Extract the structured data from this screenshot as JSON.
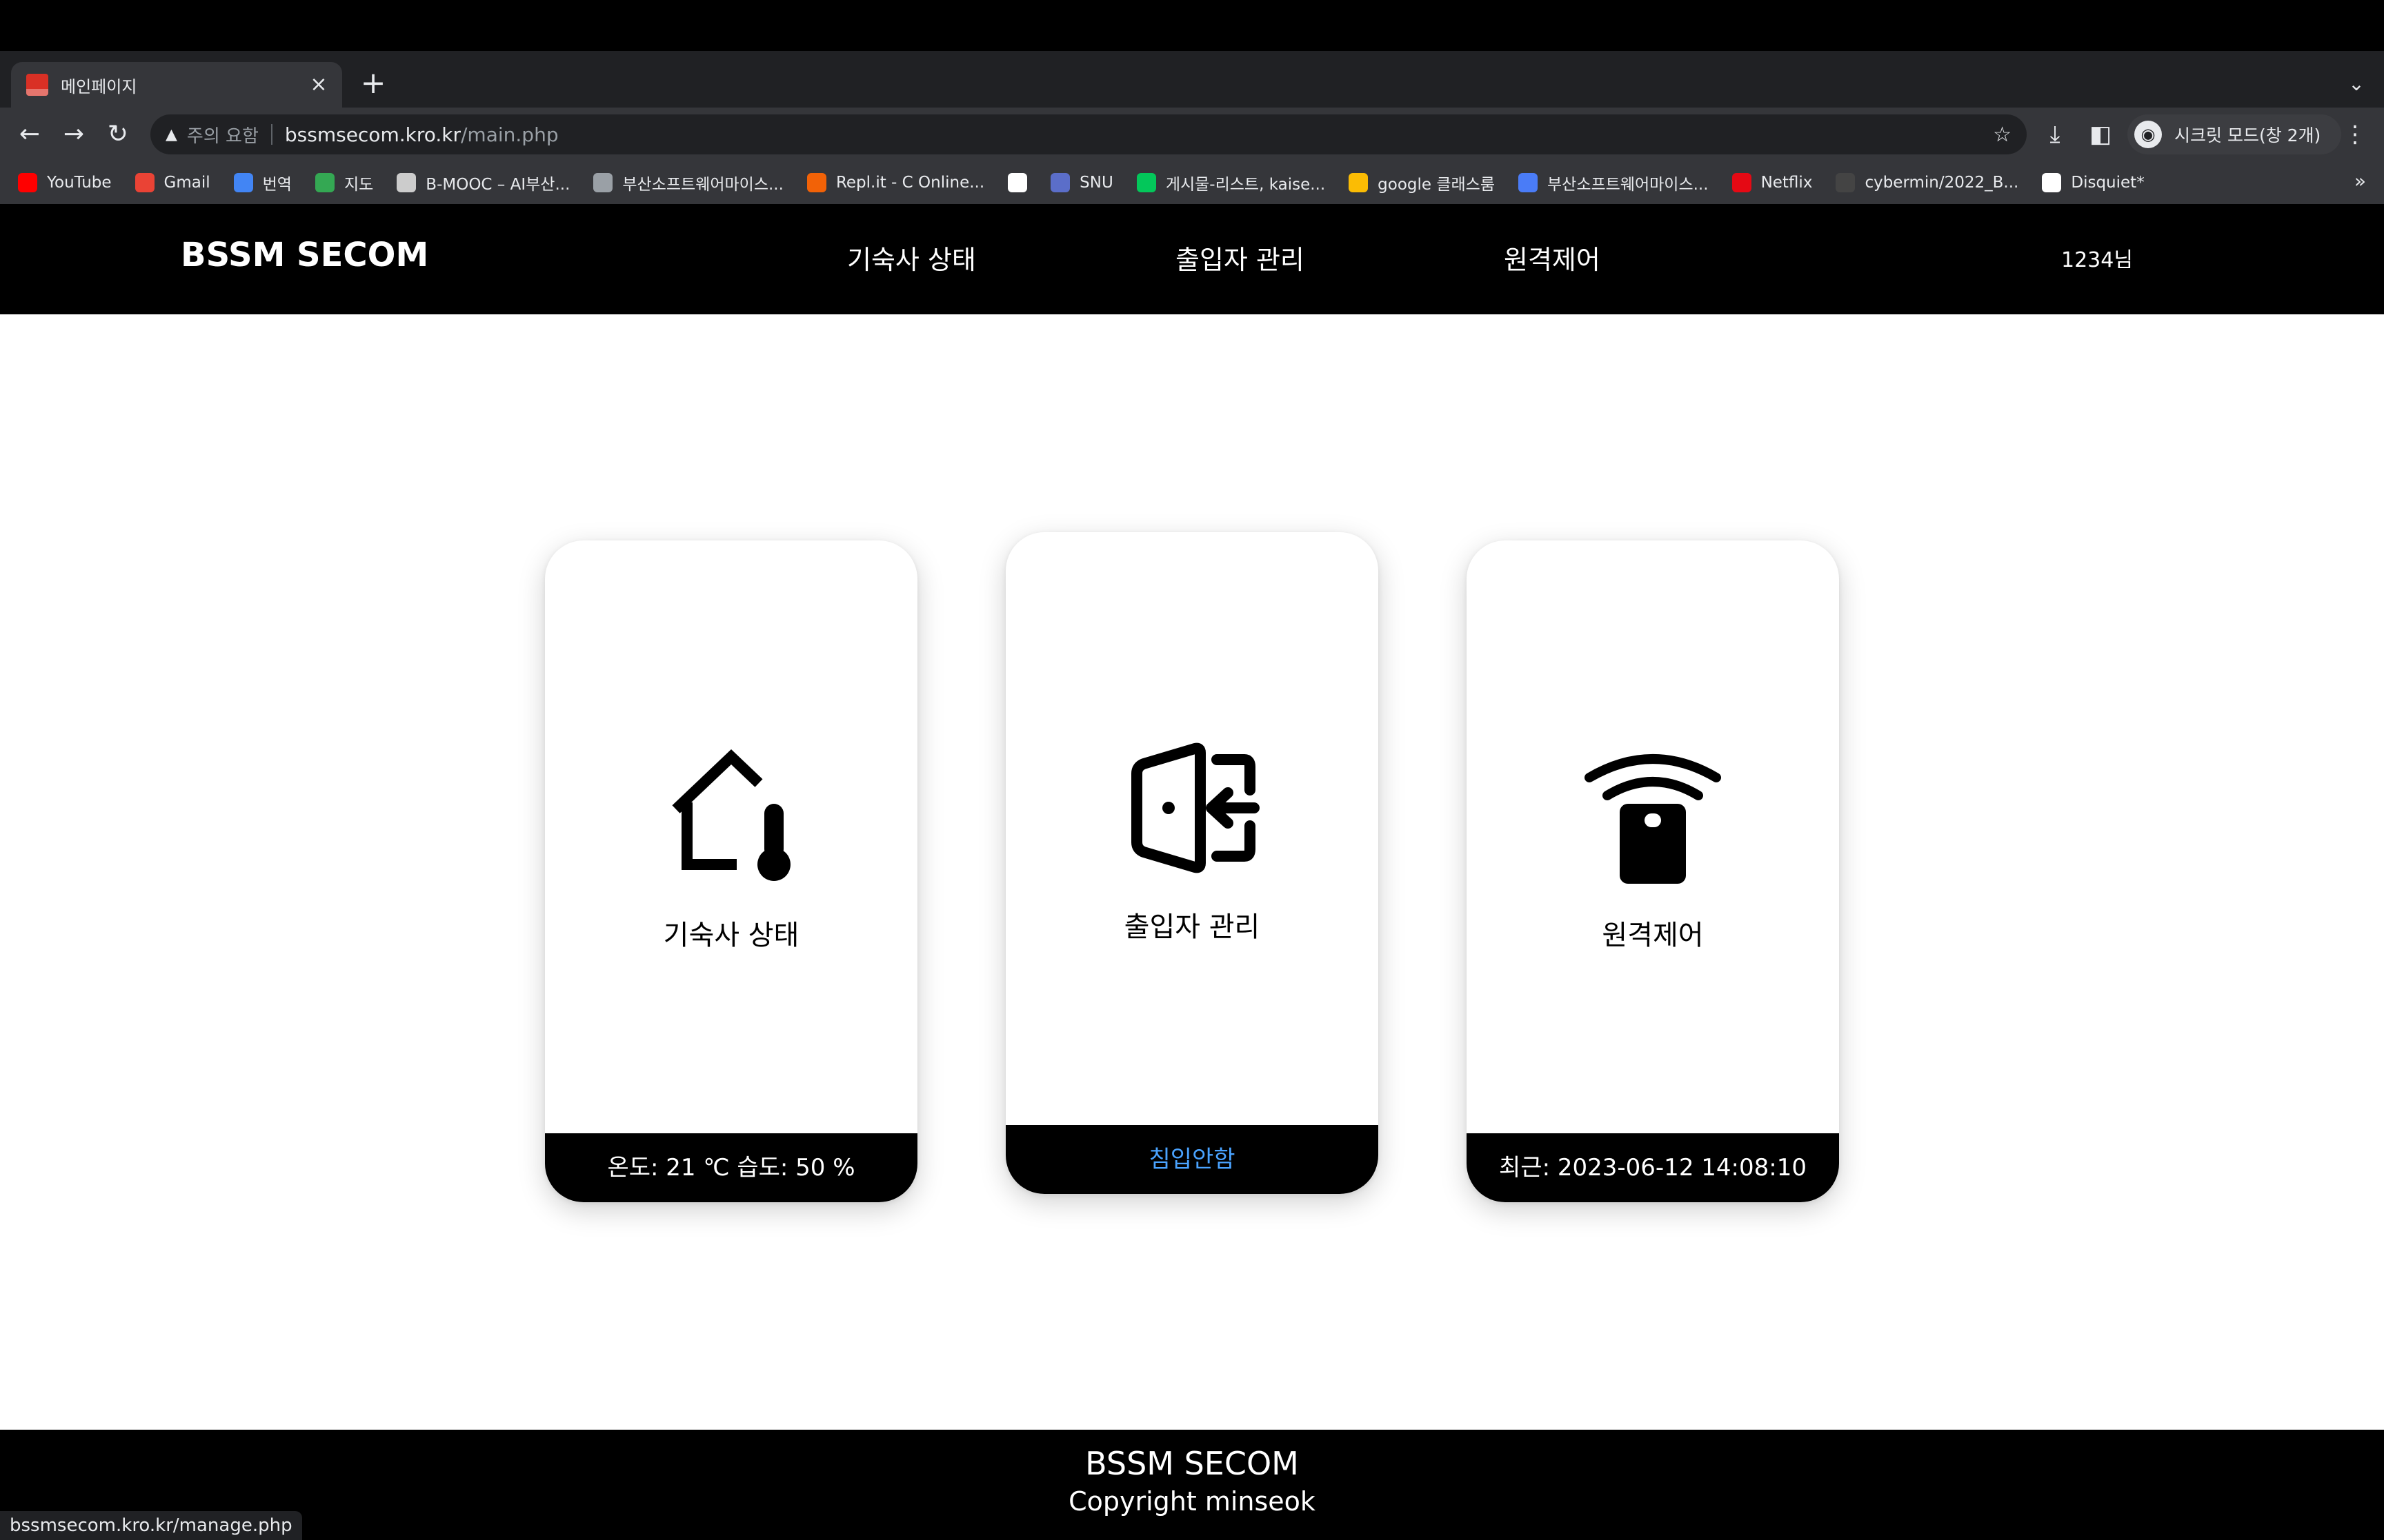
{
  "browser": {
    "tab": {
      "title": "메인페이지"
    },
    "omnibox": {
      "security_label": "주의 요함",
      "url_host": "bssmsecom.kro.kr",
      "url_path": "/main.php"
    },
    "incognito_label": "시크릿 모드(창 2개)",
    "bookmarks": [
      {
        "label": "YouTube",
        "color": "#ff0000"
      },
      {
        "label": "Gmail",
        "color": "#ea4335"
      },
      {
        "label": "번역",
        "color": "#4285f4"
      },
      {
        "label": "지도",
        "color": "#34a853"
      },
      {
        "label": "B-MOOC – AI부산...",
        "color": "#cccccc"
      },
      {
        "label": "부산소프트웨어마이스...",
        "color": "#9aa0a6"
      },
      {
        "label": "Repl.it - C Online...",
        "color": "#f26207"
      },
      {
        "label": "",
        "color": "#ffffff"
      },
      {
        "label": "SNU",
        "color": "#5b6ec9"
      },
      {
        "label": "게시물-리스트, kaise...",
        "color": "#03c75a"
      },
      {
        "label": "google 클래스룸",
        "color": "#fbbc04"
      },
      {
        "label": "부산소프트웨어마이스...",
        "color": "#4a7cf7"
      },
      {
        "label": "Netflix",
        "color": "#e50914"
      },
      {
        "label": "cybermin/2022_B...",
        "color": "#444444"
      },
      {
        "label": "Disquiet*",
        "color": "#ffffff"
      }
    ],
    "status_url": "bssmsecom.kro.kr/manage.php"
  },
  "site": {
    "brand": "BSSM SECOM",
    "nav": [
      "기숙사 상태",
      "출입자 관리",
      "원격제어"
    ],
    "user": "1234님",
    "cards": [
      {
        "title": "기숙사 상태",
        "icon": "house-thermometer-icon",
        "footer": "온도: 21 ℃  습도: 50 %",
        "footer_color": "#ffffff"
      },
      {
        "title": "출입자 관리",
        "icon": "door-enter-icon",
        "footer": "침입안함",
        "footer_color": "#4aa3ff"
      },
      {
        "title": "원격제어",
        "icon": "remote-control-icon",
        "footer": "최근: 2023-06-12 14:08:10",
        "footer_color": "#ffffff"
      }
    ],
    "footer": {
      "brand": "BSSM SECOM",
      "copyright": "Copyright minseok"
    }
  }
}
